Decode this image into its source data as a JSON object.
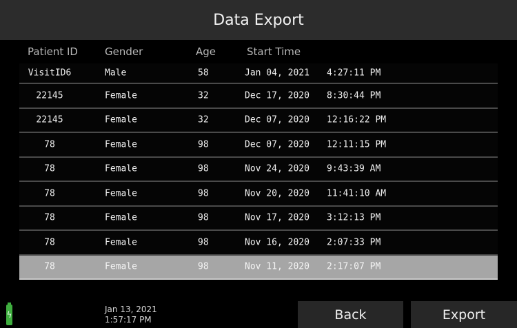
{
  "title": "Data Export",
  "columns": {
    "patient_id": "Patient ID",
    "gender": "Gender",
    "age": "Age",
    "start_time": "Start Time"
  },
  "rows": [
    {
      "patient_id": "VisitID6",
      "gender": "Male",
      "age": "58",
      "date": "Jan 04, 2021",
      "time": "4:27:11 PM"
    },
    {
      "patient_id": "22145",
      "gender": "Female",
      "age": "32",
      "date": "Dec 17, 2020",
      "time": "8:30:44 PM"
    },
    {
      "patient_id": "22145",
      "gender": "Female",
      "age": "32",
      "date": "Dec 07, 2020",
      "time": "12:16:22 PM"
    },
    {
      "patient_id": "78",
      "gender": "Female",
      "age": "98",
      "date": "Dec 07, 2020",
      "time": "12:11:15 PM"
    },
    {
      "patient_id": "78",
      "gender": "Female",
      "age": "98",
      "date": "Nov 24, 2020",
      "time": "9:43:39 AM"
    },
    {
      "patient_id": "78",
      "gender": "Female",
      "age": "98",
      "date": "Nov 20, 2020",
      "time": "11:41:10 AM"
    },
    {
      "patient_id": "78",
      "gender": "Female",
      "age": "98",
      "date": "Nov 17, 2020",
      "time": "3:12:13 PM"
    },
    {
      "patient_id": "78",
      "gender": "Female",
      "age": "98",
      "date": "Nov 16, 2020",
      "time": "2:07:33 PM"
    },
    {
      "patient_id": "78",
      "gender": "Female",
      "age": "98",
      "date": "Nov 11, 2020",
      "time": "2:17:07 PM"
    }
  ],
  "selected_row_index": 8,
  "footer": {
    "battery_icon": "battery-charging-icon",
    "battery_symbol": "ϟ",
    "date": "Jan 13, 2021",
    "time": "1:57:17 PM",
    "back_label": "Back",
    "export_label": "Export"
  },
  "colors": {
    "selected_row": "#a6a6a6",
    "battery": "#3fae3f",
    "button_bg": "#272727",
    "title_bg": "#2c2c2c"
  }
}
